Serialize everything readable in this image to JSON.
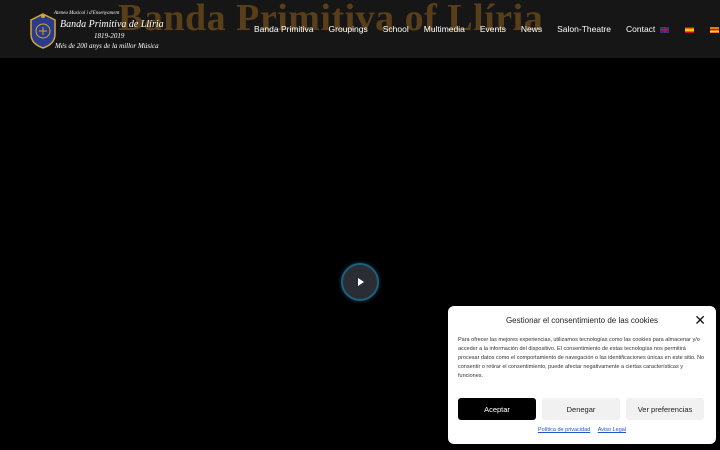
{
  "header": {
    "background_title": "Banda Primitiva of Llíria",
    "logo": {
      "line1": "Ateneu Musical i d'Ensenyament",
      "line2": "Banda Primitiva de Llíria",
      "line3": "1819-2019",
      "line4": "Més de 200 anys de la millor Música"
    },
    "nav": [
      {
        "label": "Banda Primitiva"
      },
      {
        "label": "Groupings"
      },
      {
        "label": "School"
      },
      {
        "label": "Multimedia"
      },
      {
        "label": "Events"
      },
      {
        "label": "News"
      },
      {
        "label": "Salon-Theatre"
      },
      {
        "label": "Contact"
      }
    ],
    "flags": [
      "english-flag-icon",
      "spanish-flag-icon",
      "catalan-flag-icon"
    ]
  },
  "video": {
    "play_icon": "play-icon",
    "accent_color": "#1e5f7a"
  },
  "cookie": {
    "title": "Gestionar el consentimiento de las cookies",
    "text": "Para ofrecer las mejores experiencias, utilizamos tecnologías como las cookies para almacenar y/o acceder a la información del dispositivo. El consentimiento de estas tecnologías nos permitirá procesar datos como el comportamiento de navegación o las identificaciones únicas en este sitio. No consentir o retirar el consentimiento, puede afectar negativamente a ciertas características y funciones.",
    "accept": "Aceptar",
    "deny": "Denegar",
    "preferences": "Ver preferencias",
    "privacy_link": "Política de privacidad",
    "legal_link": "Aviso Legal",
    "link_color": "#2256c7"
  }
}
